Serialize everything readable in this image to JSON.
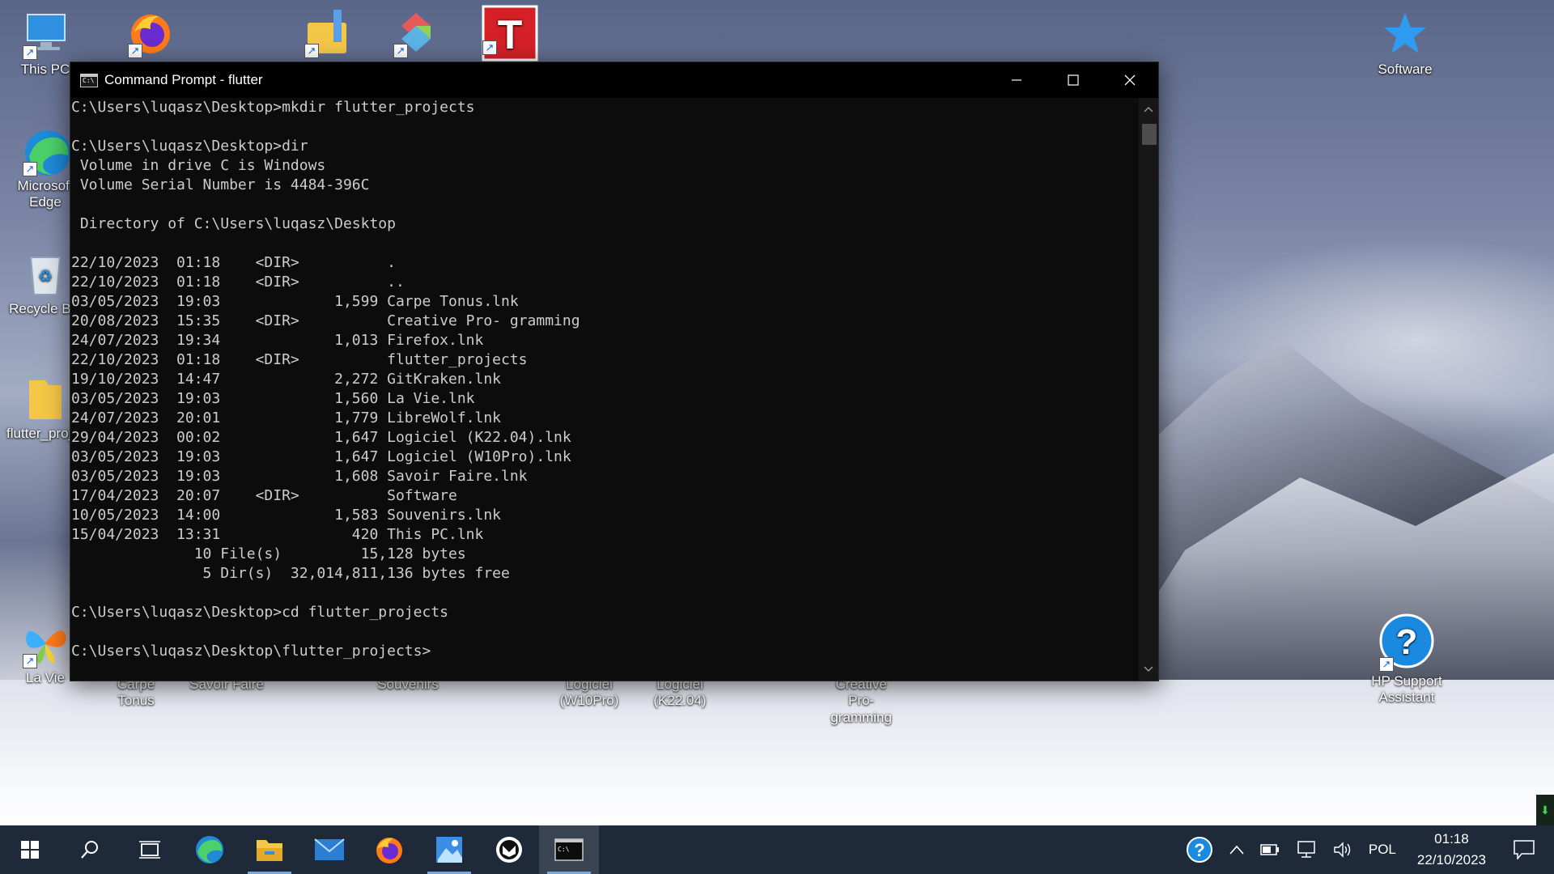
{
  "desktop_icons": [
    {
      "label": "This PC",
      "icon": "this-pc-icon"
    },
    {
      "label": "Microsoft Edge",
      "icon": "edge-icon"
    },
    {
      "label": "Recycle Bin",
      "icon": "recycle-bin-icon"
    },
    {
      "label": "flutter_projects",
      "icon": "folder-icon"
    },
    {
      "label": "La Vie",
      "icon": "butterfly-icon"
    },
    {
      "label": "Carpe Tonus",
      "icon": "shortcut-icon"
    },
    {
      "label": "Savoir Faire",
      "icon": "shortcut-icon"
    },
    {
      "label": "Souvenirs",
      "icon": "shortcut-icon"
    },
    {
      "label": "Logiciel (W10Pro)",
      "icon": "shortcut-icon"
    },
    {
      "label": "Logiciel (K22.04)",
      "icon": "shortcut-icon"
    },
    {
      "label": "Creative Pro- gramming",
      "icon": "shortcut-icon"
    },
    {
      "label": "Software",
      "icon": "star-icon"
    },
    {
      "label": "HP Support Assistant",
      "icon": "help-icon"
    }
  ],
  "window": {
    "title": "Command Prompt - flutter",
    "minimize_glyph": "—",
    "maximize_glyph": "☐",
    "close_glyph": "✕"
  },
  "console_lines": [
    "C:\\Users\\luqasz\\Desktop>mkdir flutter_projects",
    "",
    "C:\\Users\\luqasz\\Desktop>dir",
    " Volume in drive C is Windows",
    " Volume Serial Number is 4484-396C",
    "",
    " Directory of C:\\Users\\luqasz\\Desktop",
    "",
    "22/10/2023  01:18    <DIR>          .",
    "22/10/2023  01:18    <DIR>          ..",
    "03/05/2023  19:03             1,599 Carpe Tonus.lnk",
    "20/08/2023  15:35    <DIR>          Creative Pro- gramming",
    "24/07/2023  19:34             1,013 Firefox.lnk",
    "22/10/2023  01:18    <DIR>          flutter_projects",
    "19/10/2023  14:47             2,272 GitKraken.lnk",
    "03/05/2023  19:03             1,560 La Vie.lnk",
    "24/07/2023  20:01             1,779 LibreWolf.lnk",
    "29/04/2023  00:02             1,647 Logiciel (K22.04).lnk",
    "03/05/2023  19:03             1,647 Logiciel (W10Pro).lnk",
    "03/05/2023  19:03             1,608 Savoir Faire.lnk",
    "17/04/2023  20:07    <DIR>          Software",
    "10/05/2023  14:00             1,583 Souvenirs.lnk",
    "15/04/2023  13:31               420 This PC.lnk",
    "              10 File(s)         15,128 bytes",
    "               5 Dir(s)  32,014,811,136 bytes free",
    "",
    "C:\\Users\\luqasz\\Desktop>cd flutter_projects",
    "",
    "C:\\Users\\luqasz\\Desktop\\flutter_projects>"
  ],
  "taskbar": {
    "apps": [
      "start-icon",
      "search-icon",
      "task-view-icon",
      "edge-icon",
      "file-explorer-icon",
      "mail-icon",
      "firefox-icon",
      "photos-icon",
      "librewolf-icon",
      "command-prompt-icon"
    ],
    "language": "POL",
    "time": "01:18",
    "date": "22/10/2023"
  }
}
